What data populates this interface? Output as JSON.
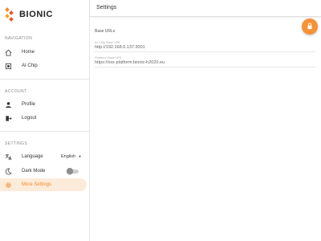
{
  "brand": {
    "name": "BIONIC",
    "accent": "#f08a2b"
  },
  "sidebar": {
    "sections": [
      {
        "title": "NAVIGATION",
        "items": [
          {
            "label": "Home",
            "icon": "home-icon"
          },
          {
            "label": "AI Chip",
            "icon": "chip-icon"
          }
        ]
      },
      {
        "title": "ACCOUNT",
        "items": [
          {
            "label": "Profile",
            "icon": "person-icon"
          },
          {
            "label": "Logout",
            "icon": "logout-icon"
          }
        ]
      },
      {
        "title": "SETTINGS",
        "items": [
          {
            "label": "Language",
            "icon": "translate-icon",
            "value": "English"
          },
          {
            "label": "Dark Mode",
            "icon": "moon-icon",
            "toggle": false
          },
          {
            "label": "More Settings",
            "icon": "gear-icon",
            "active": true
          }
        ]
      }
    ]
  },
  "main": {
    "title": "Settings",
    "group_title": "Base URLs",
    "fields": [
      {
        "label": "AI Chip Base URL",
        "value": "http://192.168.0.137:3001"
      },
      {
        "label": "Platform Base URL",
        "value": "https://xxx-platform.bionic-h2020.eu"
      }
    ],
    "fab_icon": "lock-icon",
    "fab_color": "#f4923a"
  }
}
